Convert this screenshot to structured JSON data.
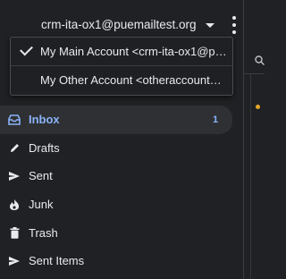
{
  "account": {
    "current_email": "crm-ita-ox1@puemailtest.org"
  },
  "menu": {
    "accounts": [
      {
        "label": "My Main Account <crm-ita-ox1@p…",
        "selected": true
      },
      {
        "label": "My Other Account <otheraccount…",
        "selected": false
      }
    ]
  },
  "folders": [
    {
      "label": "Inbox",
      "icon": "inbox-icon",
      "count": "1",
      "selected": true
    },
    {
      "label": "Drafts",
      "icon": "pencil-icon",
      "count": "",
      "selected": false
    },
    {
      "label": "Sent",
      "icon": "send-icon",
      "count": "",
      "selected": false
    },
    {
      "label": "Junk",
      "icon": "flame-icon",
      "count": "",
      "selected": false
    },
    {
      "label": "Trash",
      "icon": "trash-icon",
      "count": "",
      "selected": false
    },
    {
      "label": "Sent Items",
      "icon": "send-icon",
      "count": "",
      "selected": false
    }
  ],
  "colors": {
    "background": "#202124",
    "accent": "#8ab4f8",
    "unread_dot": "#e5a72a"
  }
}
